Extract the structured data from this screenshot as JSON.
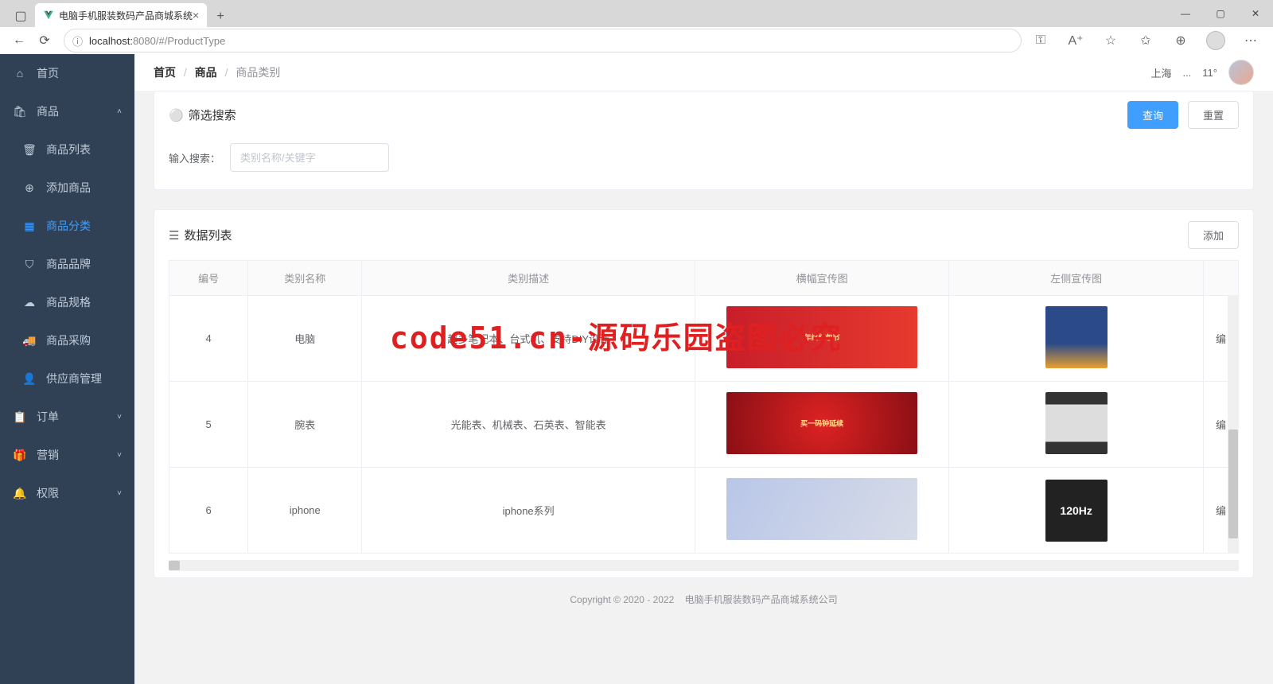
{
  "browser": {
    "tab_title": "电脑手机服装数码产品商城系统",
    "url_host": "localhost:",
    "url_port": "8080",
    "url_path": "/#/ProductType"
  },
  "sidebar": {
    "items": [
      {
        "icon": "home",
        "label": "首页"
      },
      {
        "icon": "bag",
        "label": "商品",
        "expandable": true
      },
      {
        "icon": "trash",
        "label": "商品列表",
        "sub": true
      },
      {
        "icon": "plus-circle",
        "label": "添加商品",
        "sub": true
      },
      {
        "icon": "grid",
        "label": "商品分类",
        "sub": true,
        "active": true
      },
      {
        "icon": "shield",
        "label": "商品品牌",
        "sub": true
      },
      {
        "icon": "cloud",
        "label": "商品规格",
        "sub": true
      },
      {
        "icon": "truck",
        "label": "商品采购",
        "sub": true
      },
      {
        "icon": "user",
        "label": "供应商管理",
        "sub": true
      },
      {
        "icon": "clipboard",
        "label": "订单",
        "expandable": true
      },
      {
        "icon": "gift",
        "label": "营销",
        "expandable": true
      },
      {
        "icon": "bell",
        "label": "权限",
        "expandable": true
      }
    ]
  },
  "breadcrumb": {
    "home": "首页",
    "product": "商品",
    "current": "商品类别"
  },
  "topbar": {
    "city": "上海",
    "temp": "11°"
  },
  "filter": {
    "section_title": "筛选搜索",
    "search_btn": "查询",
    "reset_btn": "重置",
    "input_label": "输入搜索：",
    "input_placeholder": "类别名称/关键字"
  },
  "list": {
    "section_title": "数据列表",
    "add_btn": "添加",
    "columns": {
      "id": "编号",
      "name": "类别名称",
      "desc": "类别描述",
      "banner": "横幅宣传图",
      "side": "左侧宣传图"
    },
    "rows": [
      {
        "id": "4",
        "name": "电脑",
        "desc": "超多笔记本、台式机、支持DIY设计",
        "banner_txt": "年终红包节",
        "side_type": "pc",
        "action": "编"
      },
      {
        "id": "5",
        "name": "腕表",
        "desc": "光能表、机械表、石英表、智能表",
        "banner_txt": "买一码钟延续",
        "side_type": "watch",
        "action": "编"
      },
      {
        "id": "6",
        "name": "iphone",
        "desc": "iphone系列",
        "banner_txt": "",
        "side_type": "phone",
        "side_txt": "120Hz",
        "action": "编"
      }
    ]
  },
  "footer": {
    "copyright": "Copyright © 2020 - 2022",
    "company": "电脑手机服装数码产品商城系统公司"
  },
  "watermark": "code51.cn-源码乐园盗图必究"
}
